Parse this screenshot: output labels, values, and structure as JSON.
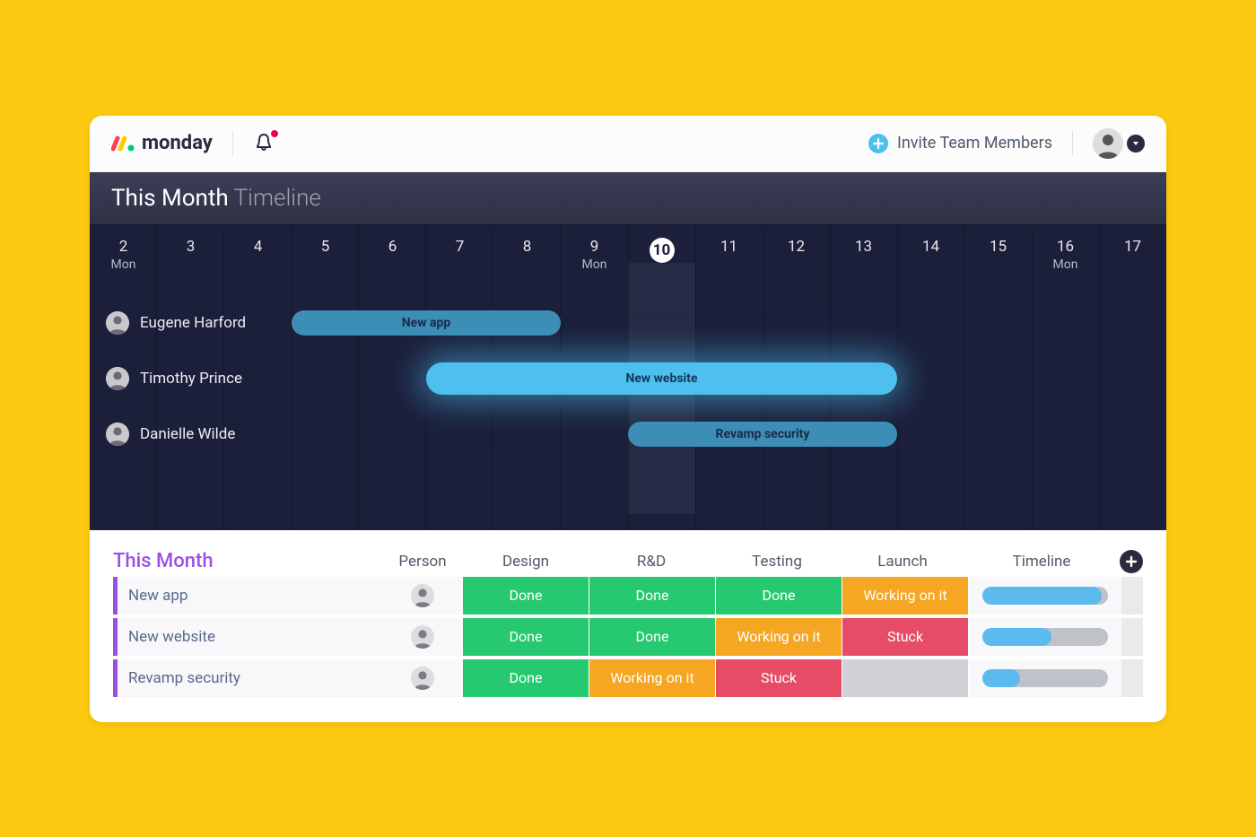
{
  "app": {
    "name": "monday"
  },
  "header": {
    "invite_label": "Invite Team Members"
  },
  "timeline": {
    "title_main": "This Month",
    "title_sub": "Timeline",
    "today": 10,
    "dates": [
      {
        "d": "2",
        "sub": "Mon"
      },
      {
        "d": "3"
      },
      {
        "d": "4"
      },
      {
        "d": "5"
      },
      {
        "d": "6"
      },
      {
        "d": "7"
      },
      {
        "d": "8"
      },
      {
        "d": "9",
        "sub": "Mon"
      },
      {
        "d": "10"
      },
      {
        "d": "11"
      },
      {
        "d": "12"
      },
      {
        "d": "13"
      },
      {
        "d": "14"
      },
      {
        "d": "15"
      },
      {
        "d": "16",
        "sub": "Mon"
      },
      {
        "d": "17"
      }
    ],
    "rows": [
      {
        "person": "Eugene Harford",
        "bar_label": "New app",
        "start": 5,
        "end": 8,
        "style": "dark"
      },
      {
        "person": "Timothy Prince",
        "bar_label": "New website",
        "start": 7,
        "end": 13,
        "style": "bright"
      },
      {
        "person": "Danielle Wilde",
        "bar_label": "Revamp security",
        "start": 10,
        "end": 13,
        "style": "dark"
      }
    ]
  },
  "board": {
    "title": "This Month",
    "columns": {
      "person": "Person",
      "design": "Design",
      "rnd": "R&D",
      "testing": "Testing",
      "launch": "Launch",
      "timeline": "Timeline"
    },
    "status_labels": {
      "done": "Done",
      "working": "Working on it",
      "stuck": "Stuck",
      "empty": ""
    },
    "items": [
      {
        "name": "New app",
        "design": "done",
        "rnd": "done",
        "testing": "done",
        "launch": "working",
        "progress": 95
      },
      {
        "name": "New website",
        "design": "done",
        "rnd": "done",
        "testing": "working",
        "launch": "stuck",
        "progress": 55
      },
      {
        "name": "Revamp security",
        "design": "done",
        "rnd": "working",
        "testing": "stuck",
        "launch": "empty",
        "progress": 30
      }
    ]
  }
}
